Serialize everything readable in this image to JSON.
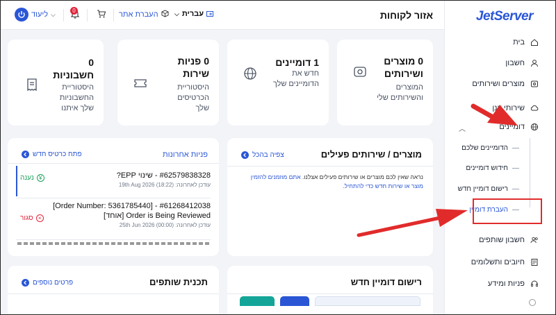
{
  "header": {
    "page_title": "אזור לקוחות",
    "language_label": "עברית",
    "transfer_label": "העברת אתר",
    "notification_count": "0",
    "user_label": "ליעוד"
  },
  "sidebar": {
    "logo": "JetServer",
    "items": [
      {
        "label": "בית",
        "icon": "home-icon"
      },
      {
        "label": "חשבון",
        "icon": "user-icon"
      },
      {
        "label": "מוצרים ושירותים",
        "icon": "box-icon"
      },
      {
        "label": "שירותי ענן",
        "icon": "cloud-icon"
      },
      {
        "label": "דומיינים",
        "icon": "globe-icon"
      },
      {
        "label": "חשבון שותפים",
        "icon": "partners-icon"
      },
      {
        "label": "חיובים ותשלומים",
        "icon": "invoice-icon"
      },
      {
        "label": "פניות ומידע",
        "icon": "support-icon"
      }
    ],
    "domain_subitems": [
      {
        "label": "הדומיינים שלכם"
      },
      {
        "label": "חידוש דומיינים"
      },
      {
        "label": "רישום דומיין חדש"
      },
      {
        "label": "העברת דומיין"
      }
    ]
  },
  "stats": [
    {
      "number": "0 מוצרים",
      "number2": "ושירותים",
      "desc": [
        "המוצרים",
        "והשירותים שלי"
      ]
    },
    {
      "number": "1 דומיינים",
      "number2": "",
      "desc": [
        "חדש את",
        "הדומיינים שלך"
      ]
    },
    {
      "number": "0 פניות",
      "number2": "שירות",
      "desc": [
        "היסטוריית",
        "הכרטיסים",
        "שלך"
      ]
    },
    {
      "number": "0",
      "number2": "חשבוניות",
      "desc": [
        "היסטוריית",
        "החשבוניות",
        "שלך איתנו"
      ]
    }
  ],
  "products_panel": {
    "title": "מוצרים / שירותים פעילים",
    "link": "צפיה בהכל",
    "notice_text": "נראה שאין לכם מוצרים או שירותים פעילים אצלנו.",
    "notice_link": "אתם מוזמנים להזמין מוצר או שירות חדש כדי להתחיל."
  },
  "tickets_panel": {
    "title": "פניות אחרונות",
    "link": "פתח כרטיס חדש",
    "tickets": [
      {
        "subject": "#62579838328 - שינוי EPP?",
        "date": "עודכן לאחרונה: 19th Aug 2026 (18:22)",
        "status": "נענה"
      },
      {
        "subject": "#61268412038 - [Order Number: 5361785440]",
        "subject2": "Order is Being Reviewed [אוחד]",
        "date": "עודכן לאחרונה: 25th Jun 2026 (00:00)",
        "status": "סגור"
      }
    ]
  },
  "domain_panel": {
    "title": "רישום דומיין חדש"
  },
  "affiliate_panel": {
    "title": "תכנית שותפים",
    "link": "פרטים נוספים"
  },
  "colors": {
    "accent": "#2a56d6",
    "success": "#18a058",
    "danger": "#e0243a",
    "annotation": "#e12b2b"
  }
}
